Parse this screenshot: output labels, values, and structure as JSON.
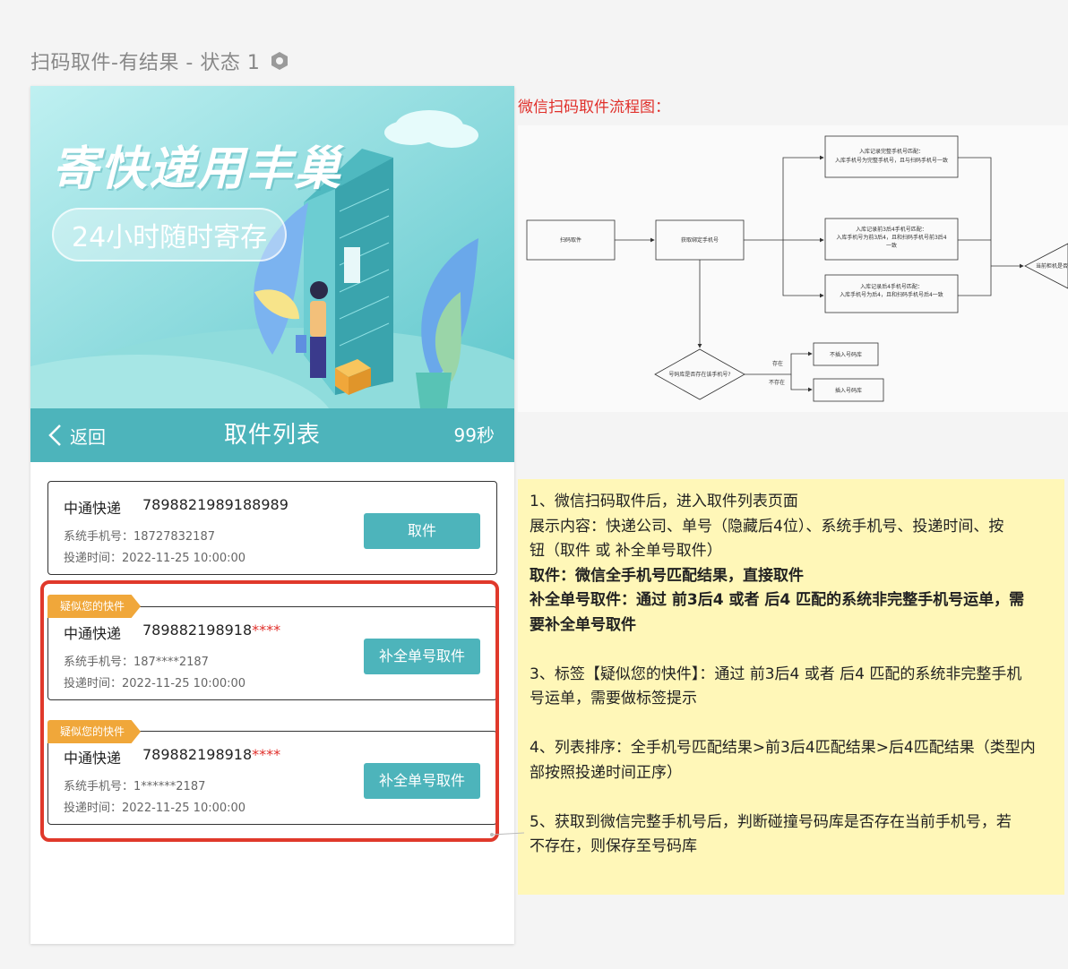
{
  "page": {
    "title": "扫码取件-有结果 - 状态 1"
  },
  "banner": {
    "title": "寄快递用丰巢",
    "subtitle": "24小时随时寄存"
  },
  "navbar": {
    "back_label": "返回",
    "title": "取件列表",
    "timer": "99秒"
  },
  "cards": [
    {
      "company": "中通快递",
      "waybill": "7898821989188989",
      "waybill_mask": "",
      "phone": "系统手机号：18727832187",
      "time": "投递时间：2022-11-25 10:00:00",
      "button": "取件",
      "tag": ""
    },
    {
      "company": "中通快递",
      "waybill": "789882198918",
      "waybill_mask": "****",
      "phone": "系统手机号：187****2187",
      "time": "投递时间：2022-11-25 10:00:00",
      "button": "补全单号取件",
      "tag": "疑似您的快件"
    },
    {
      "company": "中通快递",
      "waybill": "789882198918",
      "waybill_mask": "****",
      "phone": "系统手机号：1******2187",
      "time": "投递时间：2022-11-25 10:00:00",
      "button": "补全单号取件",
      "tag": "疑似您的快件"
    }
  ],
  "flowchart": {
    "caption": "微信扫码取件流程图：",
    "start": "扫码取件",
    "step": "获取绑定手机号",
    "match_full_1": "入库记录完整手机号匹配：",
    "match_full_2": "入库手机号为完整手机号，且与扫码手机号一致",
    "match_34_1": "入库记录前3后4手机号匹配：",
    "match_34_2": "入库手机号为前3后4，且和扫码手机号前3后4",
    "match_34_3": "一致",
    "match_4_1": "入库记录后4手机号匹配：",
    "match_4_2": "入库手机号为后4，且和扫码手机号后4一致",
    "decision_right": "当前柜机是否",
    "decision_db": "号码库是否存在该手机号?",
    "yes": "存在",
    "no": "不存在",
    "no_insert": "不插入号码库",
    "insert": "插入号码库"
  },
  "note": {
    "l1": "1、微信扫码取件后，进入取件列表页面",
    "l2": "展示内容：快递公司、单号（隐藏后4位）、系统手机号、投递时间、按",
    "l3": "钮（取件 或 补全单号取件）",
    "l4": "取件：微信全手机号匹配结果，直接取件",
    "l5": "补全单号取件：通过 前3后4 或者 后4 匹配的系统非完整手机号运单，需",
    "l6": "要补全单号取件",
    "l7": "3、标签【疑似您的快件】：通过 前3后4 或者 后4 匹配的系统非完整手机",
    "l8": "号运单，需要做标签提示",
    "l9": "4、列表排序：全手机号匹配结果>前3后4匹配结果>后4匹配结果（类型内",
    "l10": "部按照投递时间正序）",
    "l11": "5、获取到微信完整手机号后，判断碰撞号码库是否存在当前手机号，若",
    "l12": "不存在，则保存至号码库"
  },
  "colors": {
    "teal": "#4db4bb",
    "tag_orange": "#f0a73a",
    "highlight_red": "#e0392b",
    "note_yellow": "#fff7b8"
  }
}
